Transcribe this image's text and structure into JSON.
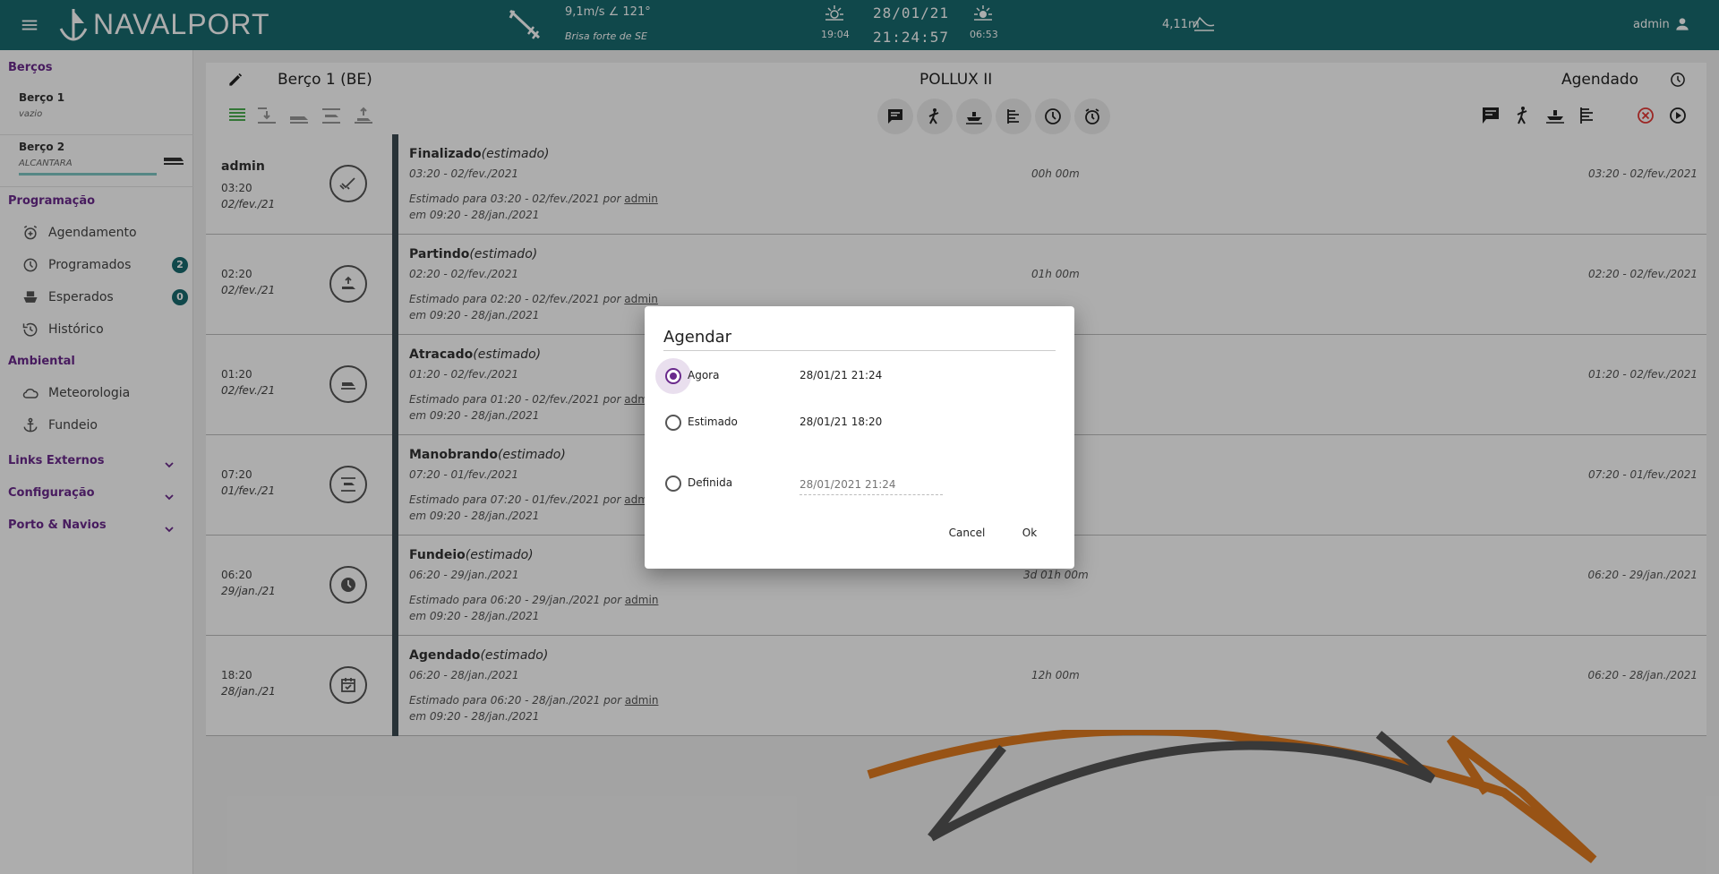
{
  "topbar": {
    "brand": "NAVALPORT",
    "wind_speed": "9,1m/s ∠ 121°",
    "wind_desc": "Brisa forte de SE",
    "sunset_time": "19:04",
    "date": "28/01/21",
    "time": "21:24:57",
    "sunrise_time": "06:53",
    "tide": "4,11m",
    "user": "admin"
  },
  "sidebar": {
    "bercos_title": "Berços",
    "berths": [
      {
        "name": "Berço 1",
        "state": "vazio"
      },
      {
        "name": "Berço 2",
        "state": "ALCANTARA"
      }
    ],
    "programacao_title": "Programação",
    "programacao_items": [
      {
        "label": "Agendamento",
        "icon": "alarm-add-icon"
      },
      {
        "label": "Programados",
        "icon": "clock-icon",
        "badge": "2"
      },
      {
        "label": "Esperados",
        "icon": "ship-icon",
        "badge": "0"
      },
      {
        "label": "Histórico",
        "icon": "history-icon"
      }
    ],
    "ambiental_title": "Ambiental",
    "ambiental_items": [
      {
        "label": "Meteorologia",
        "icon": "cloud-icon"
      },
      {
        "label": "Fundeio",
        "icon": "anchor-icon"
      }
    ],
    "collapsibles": [
      "Links Externos",
      "Configuração",
      "Porto & Navios"
    ]
  },
  "header": {
    "berth": "Berço 1 (BE)",
    "ship": "POLLUX II",
    "status": "Agendado"
  },
  "timeline": [
    {
      "who": "admin",
      "time": "03:20",
      "date": "02/fev./21",
      "icon": "check-icon",
      "title": "Finalizado",
      "tag": "(estimado)",
      "sub": "03:20 - 02/fev./2021",
      "est_prefix": "Estimado para 03:20 - 02/fev./2021 por ",
      "est_user": "admin",
      "est_on": "em 09:20 - 28/jan./2021",
      "duration": "00h 00m",
      "range": "03:20 - 02/fev./2021"
    },
    {
      "who": "",
      "time": "02:20",
      "date": "02/fev./21",
      "icon": "depart-icon",
      "title": "Partindo",
      "tag": "(estimado)",
      "sub": "02:20 - 02/fev./2021",
      "est_prefix": "Estimado para 02:20 - 02/fev./2021 por ",
      "est_user": "admin",
      "est_on": "em 09:20 - 28/jan./2021",
      "duration": "01h 00m",
      "range": "02:20 - 02/fev./2021"
    },
    {
      "who": "",
      "time": "01:20",
      "date": "02/fev./21",
      "icon": "docked-icon",
      "title": "Atracado",
      "tag": "(estimado)",
      "sub": "01:20 - 02/fev./2021",
      "est_prefix": "Estimado para 01:20 - 02/fev./2021 por ",
      "est_user": "admin",
      "est_on": "em 09:20 - 28/jan./2021",
      "duration": "",
      "range": "01:20 - 02/fev./2021"
    },
    {
      "who": "",
      "time": "07:20",
      "date": "01/fev./21",
      "icon": "maneuver-icon",
      "title": "Manobrando",
      "tag": "(estimado)",
      "sub": "07:20 - 01/fev./2021",
      "est_prefix": "Estimado para 07:20 - 01/fev./2021 por ",
      "est_user": "admin",
      "est_on": "em 09:20 - 28/jan./2021",
      "duration": "",
      "range": "07:20 - 01/fev./2021"
    },
    {
      "who": "",
      "time": "06:20",
      "date": "29/jan./21",
      "icon": "clock-icon",
      "title": "Fundeio",
      "tag": "(estimado)",
      "sub": "06:20 - 29/jan./2021",
      "est_prefix": "Estimado para 06:20 - 29/jan./2021 por ",
      "est_user": "admin",
      "est_on": "em 09:20 - 28/jan./2021",
      "duration": "3d 01h 00m",
      "range": "06:20 - 29/jan./2021"
    },
    {
      "who": "",
      "time": "18:20",
      "date": "28/jan./21",
      "icon": "calendar-check-icon",
      "title": "Agendado",
      "tag": "(estimado)",
      "sub": "06:20 - 28/jan./2021",
      "est_prefix": "Estimado para 06:20 - 28/jan./2021 por ",
      "est_user": "admin",
      "est_on": "em 09:20 - 28/jan./2021",
      "duration": "12h 00m",
      "range": "06:20 - 28/jan./2021"
    }
  ],
  "dialog": {
    "title": "Agendar",
    "options": [
      {
        "label": "Agora",
        "value": "28/01/21 21:24",
        "selected": true
      },
      {
        "label": "Estimado",
        "value": "28/01/21 18:20",
        "selected": false
      },
      {
        "label": "Definida",
        "value": "",
        "selected": false
      }
    ],
    "input_placeholder": "28/01/2021 21:24",
    "cancel_label": "Cancel",
    "ok_label": "Ok"
  },
  "colors": {
    "topbar": "#196a6f",
    "accent_purple": "#6a2a8c",
    "badge": "#196a6f",
    "cancel_red": "#e53935",
    "watermark_orange": "#e07b1f",
    "watermark_gray": "#555555"
  }
}
